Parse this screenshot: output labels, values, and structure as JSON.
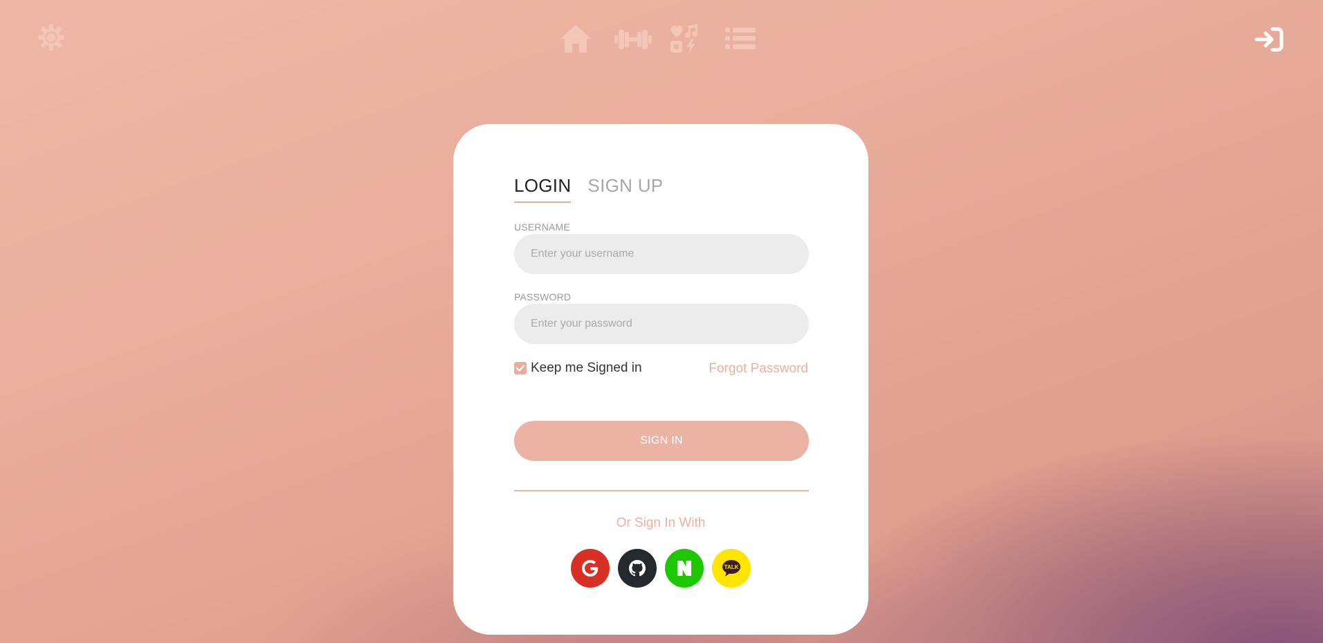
{
  "nav": {
    "settings_icon": "sun-gear-icon",
    "home_icon": "home-icon",
    "workout_icon": "dumbbell-icon",
    "activities_icon": "activities-icon",
    "list_icon": "list-icon",
    "login_icon": "sign-in-icon"
  },
  "auth": {
    "tab_login": "LOGIN",
    "tab_signup": "SIGN UP",
    "username_label": "USERNAME",
    "username_placeholder": "Enter your username",
    "username_value": "",
    "password_label": "PASSWORD",
    "password_placeholder": "Enter your password",
    "password_value": "",
    "keep_signed_in_label": "Keep me Signed in",
    "keep_signed_in_checked": true,
    "forgot_password": "Forgot Password",
    "signin_button": "SIGN IN",
    "or_sign_in_with": "Or Sign In With",
    "social_providers": [
      {
        "name": "Google",
        "icon": "google-icon",
        "color": "#d93025"
      },
      {
        "name": "GitHub",
        "icon": "github-icon",
        "color": "#24292e"
      },
      {
        "name": "Naver",
        "icon": "naver-icon",
        "color": "#1ec800"
      },
      {
        "name": "Kakao",
        "icon": "kakao-talk-icon",
        "color": "#fee500"
      }
    ],
    "kakao_badge_text": "TALK"
  },
  "colors": {
    "accent": "#e9ad9c",
    "nav_icon": "#f4c6b8",
    "card_bg": "#ffffff",
    "input_bg": "#ececec"
  }
}
